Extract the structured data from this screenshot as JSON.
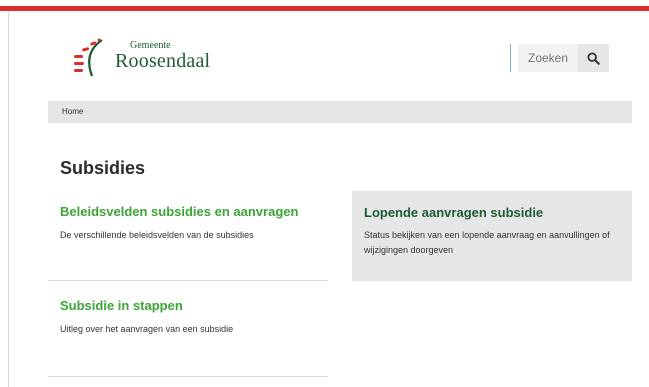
{
  "logo": {
    "small_text": "Gemeente",
    "name": "Roosendaal",
    "colors": {
      "red": "#d9302b",
      "green": "#1e5b35"
    }
  },
  "search": {
    "placeholder": "Zoeken",
    "icon": "search-icon"
  },
  "breadcrumb": {
    "home": "Home"
  },
  "page": {
    "title": "Subsidies"
  },
  "cards": [
    {
      "title": "Beleidsvelden subsidies en aanvragen",
      "description": "De verschillende beleidsvelden van de subsidies"
    },
    {
      "title": "Lopende aanvragen subsidie",
      "description": "Status bekijken van een lopende aanvraag en aanvullingen of wijzigingen doorgeven"
    },
    {
      "title": "Subsidie in stappen",
      "description": "Uitleg over het aanvragen van een subsidie"
    }
  ],
  "colors": {
    "accent_red": "#d9302b",
    "link_green": "#3aa535",
    "dark_green": "#1e5b35",
    "panel_grey": "#e6e6e6"
  }
}
